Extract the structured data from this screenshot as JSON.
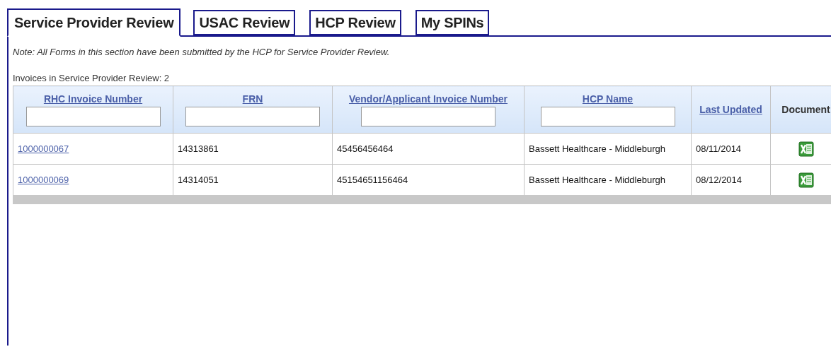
{
  "tabs": [
    {
      "label": "Service Provider Review",
      "selected": true
    },
    {
      "label": "USAC Review",
      "selected": false
    },
    {
      "label": "HCP Review",
      "selected": false
    },
    {
      "label": "My SPINs",
      "selected": false
    }
  ],
  "note": "Note: All Forms in this section have been submitted by the HCP for Service Provider Review.",
  "count_label": "Invoices in Service Provider Review: 2",
  "table": {
    "columns": [
      {
        "label": "RHC Invoice Number",
        "kind": "filter"
      },
      {
        "label": "FRN",
        "kind": "filter"
      },
      {
        "label": "Vendor/Applicant Invoice Number",
        "kind": "filter"
      },
      {
        "label": "HCP Name",
        "kind": "filter"
      },
      {
        "label": "Last Updated",
        "kind": "link"
      },
      {
        "label": "Document",
        "kind": "plain"
      }
    ],
    "rows": [
      {
        "invoice": "1000000067",
        "frn": "14313861",
        "vendor_invoice": "45456456464",
        "hcp_name": "Bassett Healthcare - Middleburgh",
        "last_updated": "08/11/2014"
      },
      {
        "invoice": "1000000069",
        "frn": "14314051",
        "vendor_invoice": "45154651156464",
        "hcp_name": "Bassett Healthcare - Middleburgh",
        "last_updated": "08/12/2014"
      }
    ]
  }
}
